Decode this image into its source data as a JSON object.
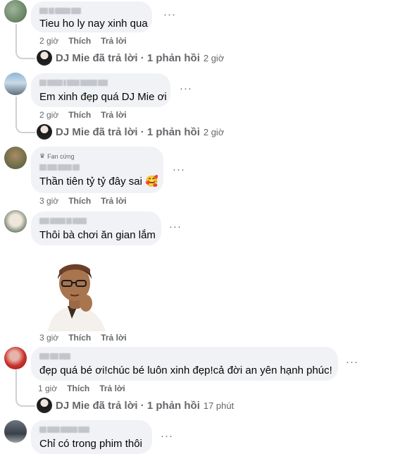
{
  "comments": [
    {
      "text": "Tieu ho ly nay xinh qua",
      "time": "2 giờ",
      "like": "Thích",
      "reply": "Trả lời",
      "more": "···",
      "replies_summary": {
        "author": "DJ Mie",
        "text": "DJ Mie đã trả lời · 1 phản hồi",
        "time": "2 giờ"
      }
    },
    {
      "text": "Em xinh đẹp quá DJ Mie ơi",
      "time": "2 giờ",
      "like": "Thích",
      "reply": "Trả lời",
      "more": "···",
      "replies_summary": {
        "author": "DJ Mie",
        "text": "DJ Mie đã trả lời · 1 phản hồi",
        "time": "2 giờ"
      }
    },
    {
      "badge": "Fan cứng",
      "text": "Thần tiên tỷ tỷ đây sai",
      "emoji": "🥰",
      "time": "3 giờ",
      "like": "Thích",
      "reply": "Trả lời",
      "more": "···"
    },
    {
      "text": "Thôi bà chơi ăn gian lắm",
      "more": "···"
    },
    {
      "sticker": "avatar-sticker",
      "time": "3 giờ",
      "like": "Thích",
      "reply": "Trả lời"
    },
    {
      "text": "đẹp quá bé ơi!chúc bé luôn xinh đẹp!cả đời an yên hạnh phúc!",
      "time": "1 giờ",
      "like": "Thích",
      "reply": "Trả lời",
      "more": "···",
      "replies_summary": {
        "author": "DJ Mie",
        "text": "DJ Mie đã trả lời · 1 phản hồi",
        "time": "17 phút"
      }
    },
    {
      "text": "Chỉ có trong phim thôi",
      "more": "···"
    }
  ],
  "colors": {
    "bubble": "#f0f2f5",
    "secondary_text": "#65676b",
    "thread_line": "#ced0d4"
  }
}
